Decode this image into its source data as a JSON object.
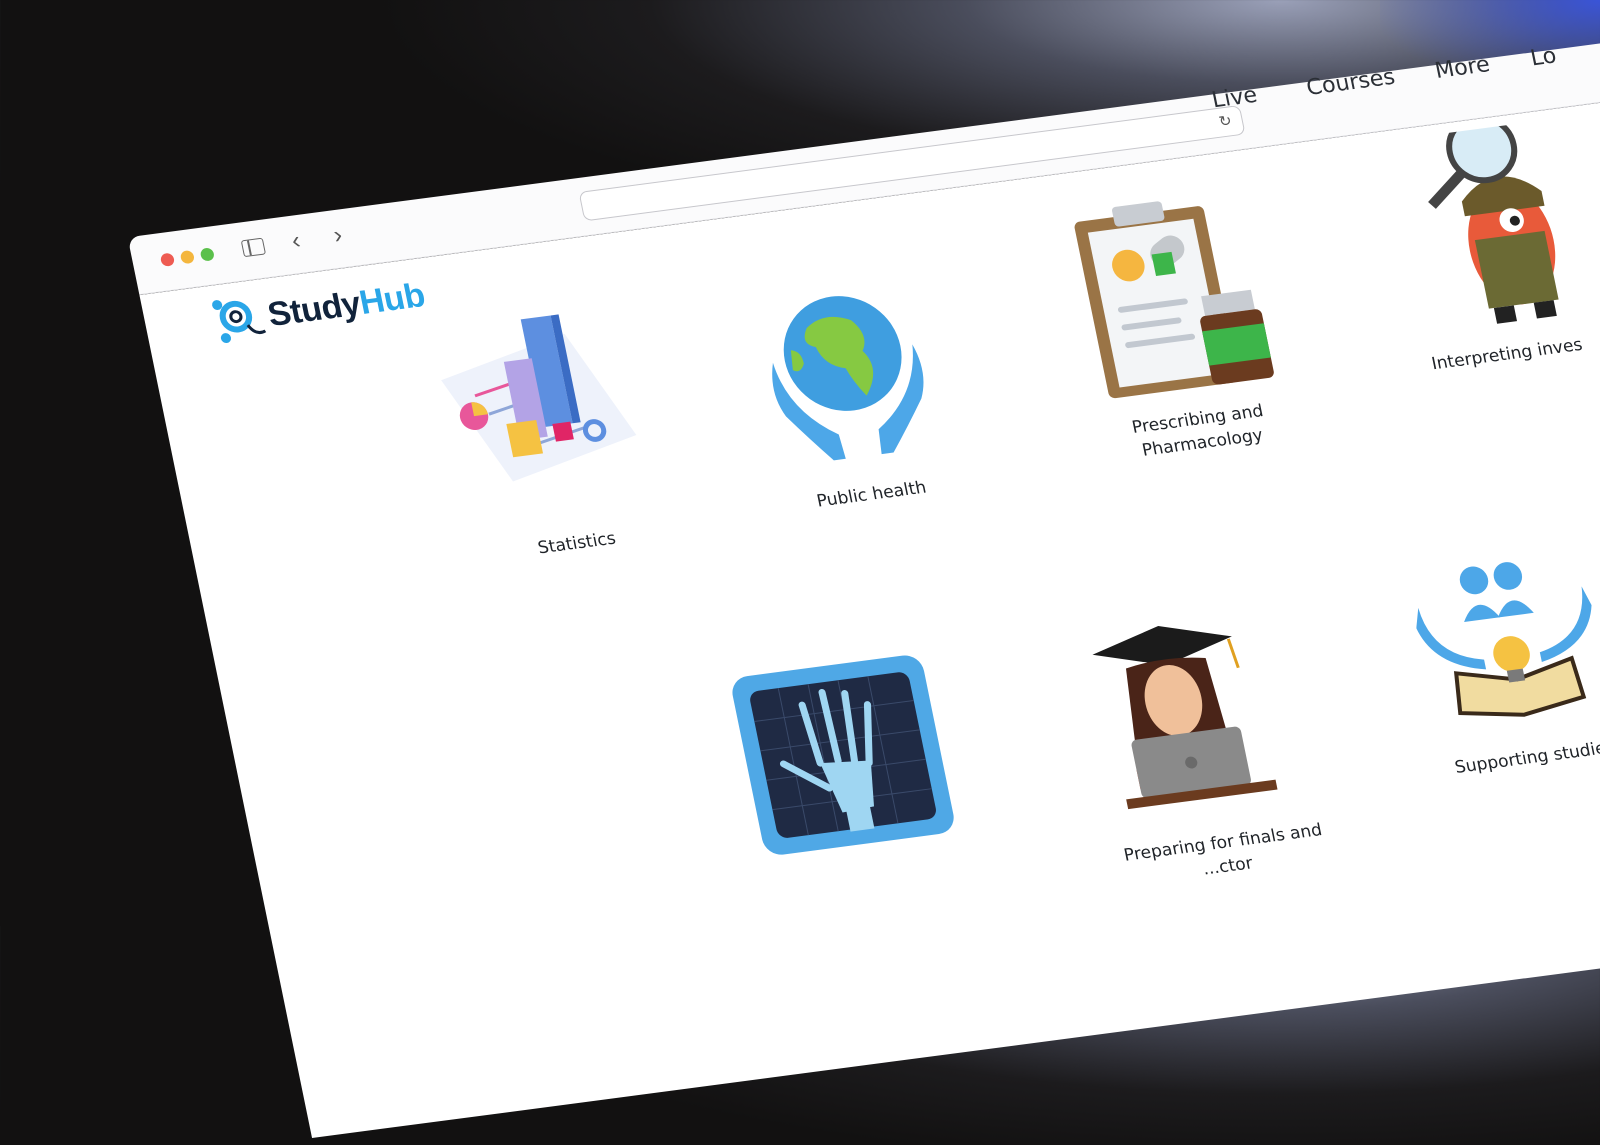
{
  "browser": {
    "url": "",
    "nav_back": "‹",
    "nav_forward": "›",
    "reload": "↻"
  },
  "logo": {
    "part1": "Study",
    "part2": "Hub"
  },
  "nav": {
    "items": [
      "Live",
      "Courses",
      "More",
      "Lo"
    ]
  },
  "courses": [
    {
      "label": "Statistics",
      "icon": "statistics-chart-icon"
    },
    {
      "label": "Public health",
      "icon": "globe-hands-icon"
    },
    {
      "label": "Prescribing and Pharmacology",
      "icon": "clipboard-pills-icon"
    },
    {
      "label": "Interpreting inves",
      "icon": "detective-magnifier-icon"
    },
    {
      "label": "",
      "icon": "xray-hand-icon"
    },
    {
      "label": "Preparing for finals and",
      "label2": "...ctor",
      "icon": "graduate-laptop-icon"
    },
    {
      "label": "Supporting studies",
      "icon": "hands-book-lightbulb-icon"
    }
  ],
  "colors": {
    "brand_dark": "#11233b",
    "brand_blue": "#2aa6e8"
  }
}
